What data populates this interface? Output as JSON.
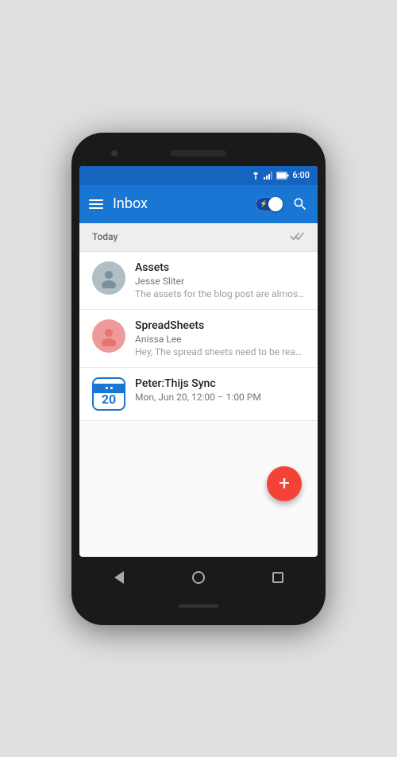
{
  "status_bar": {
    "time": "6:00",
    "wifi": "wifi",
    "signal": "signal",
    "battery": "battery"
  },
  "app_bar": {
    "title": "Inbox",
    "menu_label": "Menu",
    "toggle_label": "Toggle view",
    "search_label": "Search"
  },
  "today_section": {
    "label": "Today",
    "mark_done_label": "Mark all done"
  },
  "inbox_items": [
    {
      "id": "item-1",
      "subject": "Assets",
      "sender": "Jesse Sliter",
      "preview": "The assets for the blog post are almost done. I ex…",
      "avatar_type": "person",
      "avatar_color": "#b0bec5"
    },
    {
      "id": "item-2",
      "subject": "SpreadSheets",
      "sender": "Anissa Lee",
      "preview": "Hey, The spread sheets need to be ready in time fo…",
      "avatar_type": "person",
      "avatar_color": "#ef9a9a"
    },
    {
      "id": "item-3",
      "subject": "Peter:Thijs Sync",
      "sender": "",
      "preview": "",
      "event_time": "Mon, Jun 20, 12:00 – 1:00 PM",
      "avatar_type": "calendar",
      "calendar_day": "20"
    }
  ],
  "fab": {
    "label": "+"
  },
  "nav": {
    "back": "back",
    "home": "home",
    "recents": "recents"
  }
}
